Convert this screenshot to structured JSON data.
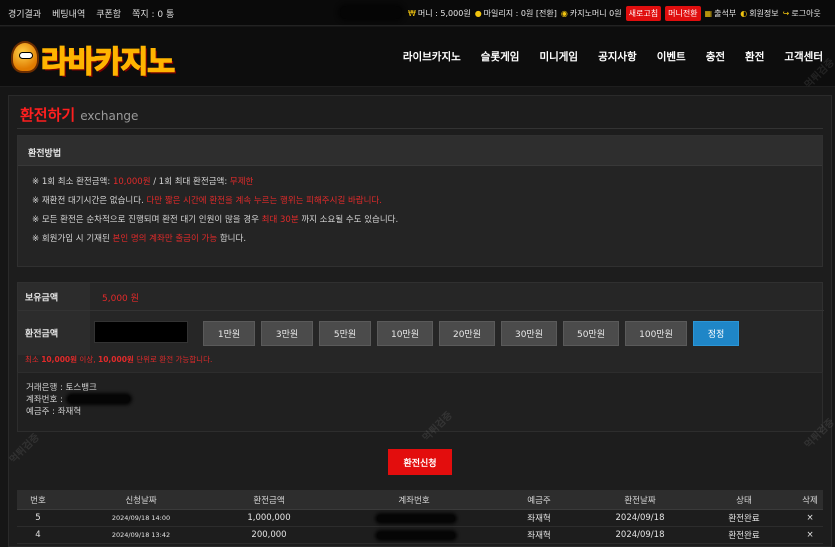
{
  "topbar": {
    "links": [
      "경기결과",
      "베팅내역",
      "쿠폰함",
      "쪽지 : 0 통"
    ],
    "money": "머니 : 5,000원",
    "mileage": "마일리지 : 0원 [전환]",
    "casino_money": "카지노머니 0원",
    "new_badge": "새로고침",
    "money_convert_badge": "머니전환",
    "attendance": "출석부",
    "member_info": "회원정보",
    "logout": "로그아웃"
  },
  "header": {
    "logo_text": "라바카지노",
    "nav": [
      "라이브카지노",
      "슬롯게임",
      "미니게임",
      "공지사항",
      "이벤트",
      "충전",
      "환전",
      "고객센터"
    ]
  },
  "page": {
    "title_ko": "환전하기",
    "title_en": "exchange"
  },
  "method": {
    "heading": "환전방법",
    "line1": {
      "a": "※ 1회 최소 환전금액: ",
      "b": "10,000원",
      "c": " / 1회 최대 환전금액: ",
      "d": "무제한"
    },
    "line2": {
      "a": "※ 재환전 대기시간은 없습니다. ",
      "b": "다만 짧은 시간에 환전을 계속 누르는 행위는 피해주시길 바랍니다."
    },
    "line3": {
      "a": "※ 모든 환전은 순차적으로 진행되며 환전 대기 인원이 많을 경우 ",
      "b": "최대 30분",
      "c": " 까지 소요될 수도 있습니다."
    },
    "line4": {
      "a": "※ 회원가입 시 기재된 ",
      "b": "본인 명의 계좌만 출금이 가능",
      "c": " 합니다."
    }
  },
  "form": {
    "balance_label": "보유금액",
    "balance_value": "5,000 원",
    "amount_label": "환전금액",
    "amount_buttons": [
      "1만원",
      "3만원",
      "5만원",
      "10만원",
      "20만원",
      "30만원",
      "50만원",
      "100만원"
    ],
    "reset_label": "정정",
    "note": {
      "a": "최소 ",
      "b": "10,000원",
      "c": " 이상, ",
      "d": "10,000원",
      "e": " 단위로 환전 가능합니다."
    }
  },
  "bank": {
    "bank_line": "거래은행 : 토스뱅크",
    "account_line": "계좌번호 : ",
    "holder_line": "예금주 : 좌재혁"
  },
  "submit_label": "환전신청",
  "history": {
    "columns": [
      "번호",
      "신청날짜",
      "환전금액",
      "계좌번호",
      "예금주",
      "환전날짜",
      "상태",
      "삭제"
    ],
    "rows": [
      {
        "no": "5",
        "req_date": "2024/09/18 14:00",
        "amount": "1,000,000",
        "holder": "좌재혁",
        "done_date": "2024/09/18",
        "status": "환전완료",
        "delete": "×"
      },
      {
        "no": "4",
        "req_date": "2024/09/18 13:42",
        "amount": "200,000",
        "holder": "좌재혁",
        "done_date": "2024/09/18",
        "status": "환전완료",
        "delete": "×"
      }
    ]
  },
  "watermark_text": "먹튀검증",
  "colors": {
    "accent_red": "#e30d0d",
    "reset_blue": "#1f86c7",
    "background": "#161616"
  }
}
